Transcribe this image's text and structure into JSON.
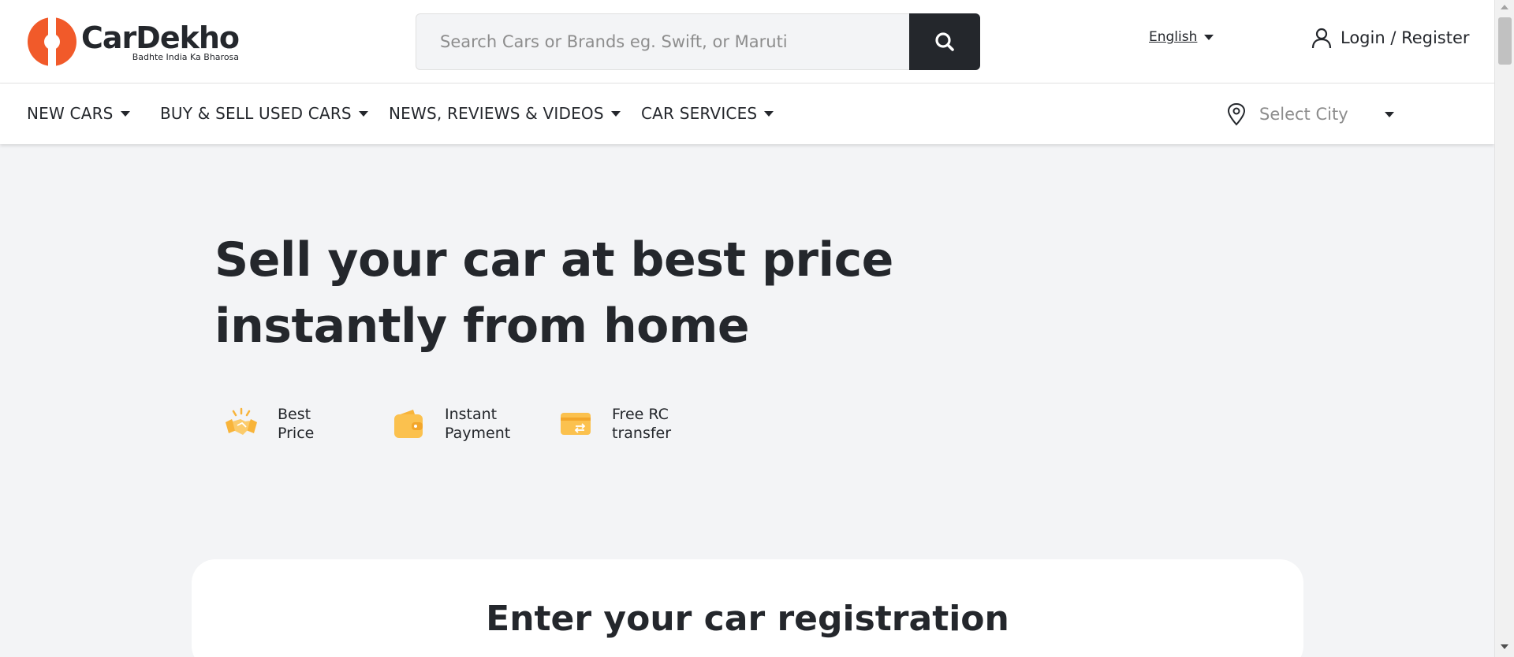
{
  "header": {
    "logo_brand": "CarDekho",
    "logo_tagline": "Badhte India Ka Bharosa",
    "search": {
      "placeholder": "Search Cars or Brands eg. Swift, or Maruti",
      "value": ""
    },
    "language": "English",
    "login_label": "Login / Register"
  },
  "nav": {
    "items": [
      {
        "label": "NEW CARS"
      },
      {
        "label": "BUY & SELL USED CARS"
      },
      {
        "label": "NEWS, REVIEWS & VIDEOS"
      },
      {
        "label": "CAR SERVICES"
      }
    ],
    "city_placeholder": "Select City"
  },
  "hero": {
    "title_line1": "Sell your car at best price",
    "title_line2": "instantly from home",
    "features": [
      {
        "line1": "Best",
        "line2": "Price",
        "icon": "handshake-icon"
      },
      {
        "line1": "Instant",
        "line2": "Payment",
        "icon": "wallet-icon"
      },
      {
        "line1": "Free RC",
        "line2": "transfer",
        "icon": "rc-card-icon"
      }
    ]
  },
  "card": {
    "title": "Enter your car registration"
  },
  "colors": {
    "brand_orange": "#f15a2a",
    "dark": "#24272c",
    "icon_yellow": "#f8b43a",
    "page_bg": "#f3f4f6"
  }
}
